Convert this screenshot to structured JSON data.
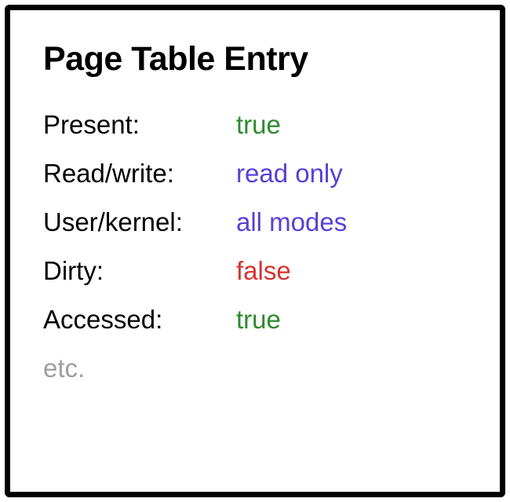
{
  "title": "Page Table Entry",
  "rows": [
    {
      "label": "Present:",
      "value": "true",
      "color": "green"
    },
    {
      "label": "Read/write:",
      "value": "read only",
      "color": "purple"
    },
    {
      "label": "User/kernel:",
      "value": "all modes",
      "color": "purple"
    },
    {
      "label": "Dirty:",
      "value": "false",
      "color": "red"
    },
    {
      "label": "Accessed:",
      "value": "true",
      "color": "green"
    }
  ],
  "footer": "etc."
}
